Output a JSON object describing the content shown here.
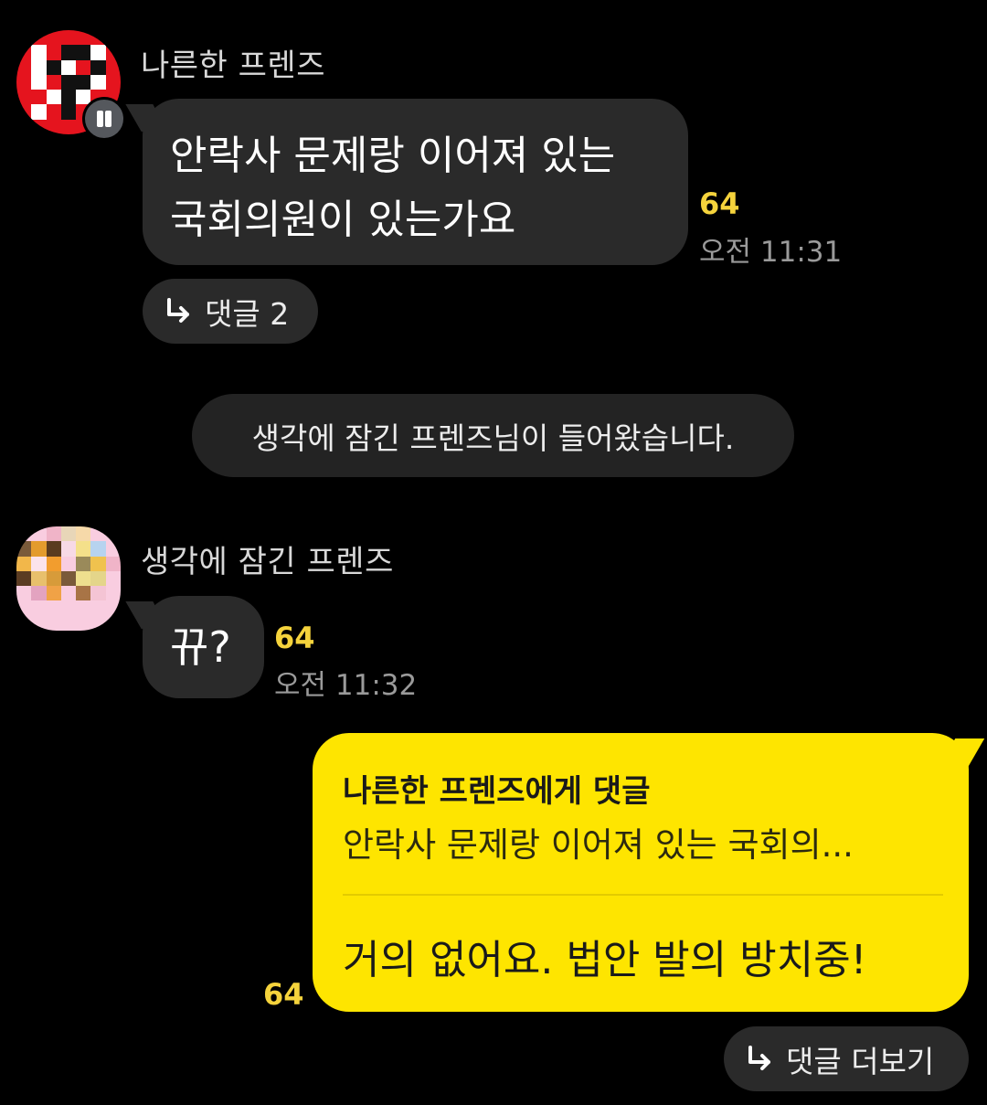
{
  "messages": [
    {
      "sender": "나른한 프렌즈",
      "lines": [
        "안락사 문제랑 이어져 있는",
        "국회의원이 있는가요"
      ],
      "unread_count": "64",
      "time": "오전 11:31",
      "reply_chip": "댓글 2"
    },
    {
      "system_notice": "생각에 잠긴 프렌즈님이 들어왔습니다."
    },
    {
      "sender": "생각에 잠긴 프렌즈",
      "text": "뀨?",
      "unread_count": "64",
      "time": "오전 11:32"
    },
    {
      "quote_title": "나른한 프렌즈에게 댓글",
      "quote_text": "안락사 문제랑 이어져 있는 국회의...",
      "text": "거의 없어요. 법안 발의 방치중!",
      "unread_count": "64",
      "reply_chip": "댓글 더보기"
    }
  ],
  "colors": {
    "background": "#000000",
    "other_bubble": "#2a2a2a",
    "my_bubble": "#fee500",
    "unread_count": "#f5d33c"
  },
  "icons": [
    "reply-arrow-icon",
    "profile-badge-icon"
  ]
}
